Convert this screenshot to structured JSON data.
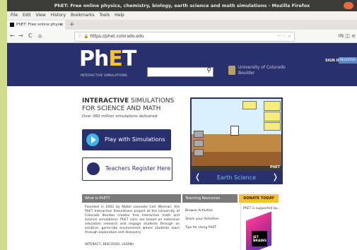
{
  "window": {
    "title": "PhET: Free online physics, chemistry, biology, earth science and math simulations - Mozilla Firefox"
  },
  "menu": [
    "File",
    "Edit",
    "View",
    "History",
    "Bookmarks",
    "Tools",
    "Help"
  ],
  "tab": {
    "label": "PhET: Free online physic",
    "close": "×",
    "new": "+"
  },
  "nav": {
    "back": "←",
    "forward": "→",
    "reload": "C",
    "home": "⌂",
    "url": "https://phet.colorado.edu",
    "url_menu": "··· ♡ ☆",
    "tool_icons": "IN ◫ ≡"
  },
  "header": {
    "logo_ph": "Ph",
    "logo_e": "E",
    "logo_t": "T",
    "logo_sub": "INTERACTIVE SIMULATIONS",
    "search_placeholder": "",
    "university_line1": "University of Colorado",
    "university_line2": "Boulder",
    "sign_in": "SIGN IN",
    "register": "REGISTER"
  },
  "main": {
    "headline_bold": "INTERACTIVE",
    "headline_rest1": "SIMULATIONS",
    "headline_line2": "FOR SCIENCE AND MATH",
    "tagline": "Over 360 million simulations delivered",
    "play_label": "Play with Simulations",
    "teachers_label": "Teachers Register Here",
    "feature_caption": "Earth Science",
    "feature_left_arrow": "❬",
    "feature_right_arrow": "❭",
    "feature_phet": "PhET"
  },
  "what_is": {
    "heading": "What is PhET?",
    "paragraph": "Founded in 2002 by Nobel Laureate Carl Wieman, the PhET Interactive Simulations project at the University of Colorado Boulder creates free interactive math and science simulations. PhET sims are based on extensive education research and engage students through an intuitive, game-like environment where students learn through exploration and discovery.",
    "tagline": "INTERACT, DISCOVER, LEARN!"
  },
  "teaching": {
    "heading": "Teaching Resources",
    "items": [
      "Browse Activities",
      "Share your Activities",
      "Tips for Using PhET"
    ]
  },
  "donate": {
    "button": "DONATE TODAY",
    "supported_by": "PhET is supported by...",
    "sponsor_line1": "JET",
    "sponsor_line2": "BRAINS"
  },
  "colors": {
    "header_bg": "#2a306e",
    "logo_accent": "#f6c32a",
    "play_circle": "#3db3e8",
    "donate": "#f6c32a"
  }
}
